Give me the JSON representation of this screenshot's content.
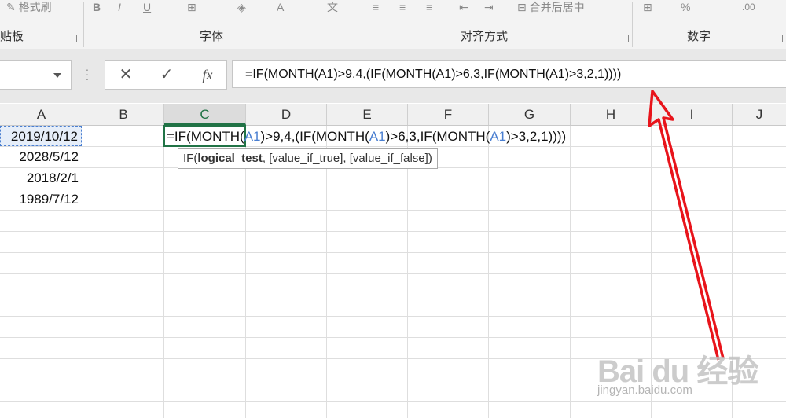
{
  "ribbon": {
    "format_painter_label": "格式刷",
    "bold": "B",
    "italic": "I",
    "underline": "U",
    "font_color_letter": "A",
    "wen_label": "文",
    "merge_label": "合并后居中",
    "percent": "%",
    "decimal_label": ".00",
    "groups": {
      "clipboard": "贴板",
      "font": "字体",
      "alignment": "对齐方式",
      "number": "数字"
    }
  },
  "formula_bar": {
    "name_box_value": "",
    "cancel_icon": "✕",
    "enter_icon": "✓",
    "fx_label": "fx",
    "formula": "=IF(MONTH(A1)>9,4,(IF(MONTH(A1)>6,3,IF(MONTH(A1)>3,2,1))))"
  },
  "columns": [
    "A",
    "B",
    "C",
    "D",
    "E",
    "F",
    "G",
    "H",
    "I",
    "J"
  ],
  "active_column": "C",
  "cells": {
    "A1": "2019/10/12",
    "A2": "2028/5/12",
    "A3": "2018/2/1",
    "A4": "1989/7/12"
  },
  "editing": {
    "p1": "=IF(MONTH(",
    "r1": "A1",
    "p2": ")>9,4,(IF(MONTH(",
    "r2": "A1",
    "p3": ")>6,3,IF(MONTH(",
    "r3": "A1",
    "p4": ")>3,2,1))))"
  },
  "tooltip": {
    "func": "IF(",
    "arg1": "logical_test",
    "rest": ", [value_if_true], [value_if_false])"
  },
  "watermark": {
    "logo_text": "Bai du 经验",
    "url": "jingyan.baidu.com"
  },
  "colors": {
    "accent_green": "#217346",
    "ref_blue": "#4a7fd1",
    "annotation_red": "#e8141b"
  }
}
